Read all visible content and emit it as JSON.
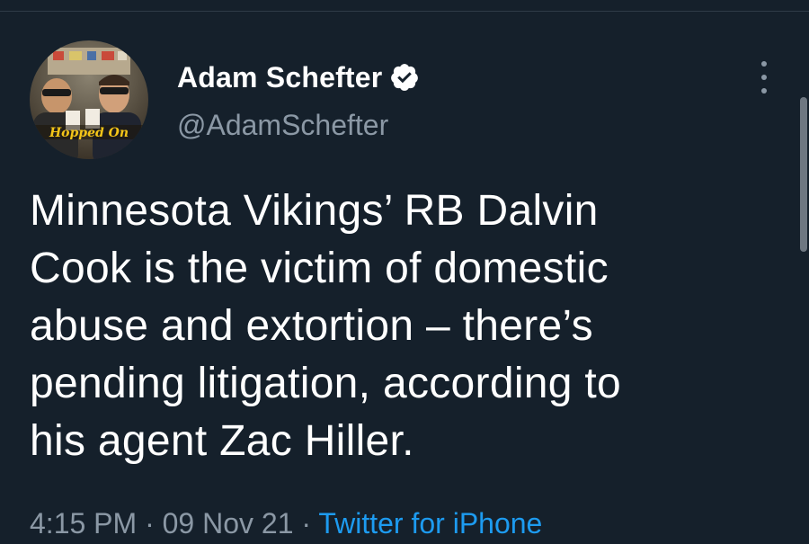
{
  "tweet": {
    "author": {
      "display_name": "Adam Schefter",
      "handle": "@AdamSchefter",
      "verified": true,
      "avatar_caption": "Hopped On"
    },
    "text": "Minnesota Vikings’ RB Dalvin\nCook is the victim of domestic\nabuse and extortion – there’s\npending litigation, according to\nhis agent Zac Hiller.",
    "time": "4:15 PM",
    "separator": "·",
    "date": "09 Nov 21",
    "source": "Twitter for iPhone"
  },
  "icons": {
    "verified": "verified-badge-icon",
    "more": "more-options-icon"
  },
  "colors": {
    "background": "#15202b",
    "text_primary": "#ffffff",
    "text_secondary": "#8b98a5",
    "link": "#1d9bf0"
  }
}
